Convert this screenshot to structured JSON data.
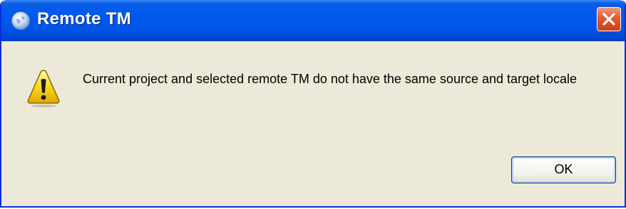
{
  "window": {
    "title": "Remote TM",
    "app_icon": "globe-app-icon",
    "close_icon": "close-icon",
    "close_button_color": "#e35a2f",
    "titlebar_color": "#0058ee",
    "body_color": "#ece9d8"
  },
  "dialog": {
    "icon": "warning-icon",
    "message": "Current project and selected remote TM do not have the same source and target locale",
    "ok_label": "OK"
  }
}
